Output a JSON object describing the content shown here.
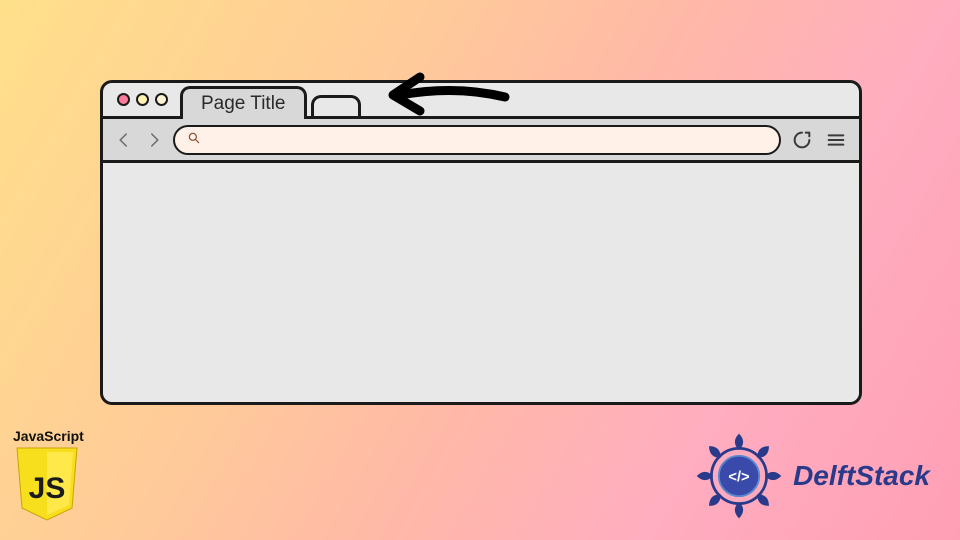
{
  "browser": {
    "tab_title": "Page Title",
    "url_value": "",
    "url_placeholder": ""
  },
  "badges": {
    "js_label": "JavaScript",
    "js_icon_text": "JS",
    "delftstack_text": "DelftStack",
    "delftstack_code_symbol": "</>"
  },
  "icons": {
    "back": "chevron-left",
    "forward": "chevron-right",
    "search": "magnifier",
    "refresh": "circular-arrow",
    "menu": "hamburger"
  },
  "colors": {
    "outline": "#1a1a1a",
    "chrome_bg": "#d8d8d8",
    "urlbar_bg": "#fff0e8",
    "js_yellow": "#f7df1e",
    "delft_blue": "#2a3a8a"
  }
}
